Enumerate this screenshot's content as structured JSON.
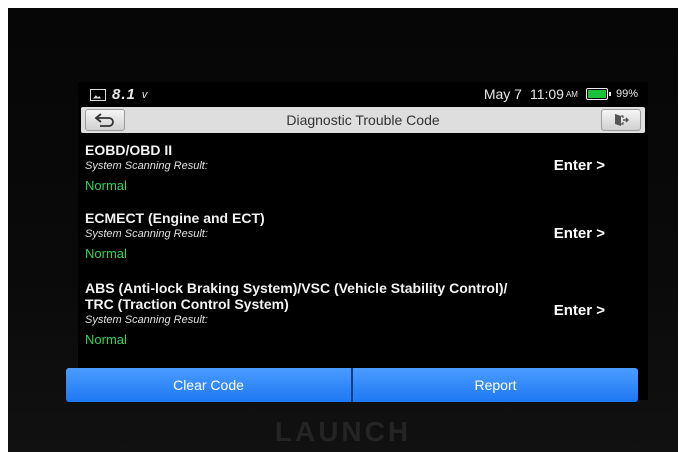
{
  "status_bar": {
    "version": "8.1",
    "version_suffix": "v",
    "date": "May 7",
    "time": "11:09",
    "ampm": "AM",
    "battery": "99%"
  },
  "header": {
    "title": "Diagnostic Trouble Code"
  },
  "systems": [
    {
      "name": "EOBD/OBD II",
      "scan_label": "System Scanning Result:",
      "status": "Normal",
      "action": "Enter >"
    },
    {
      "name": "ECMECT (Engine and ECT)",
      "scan_label": "System Scanning Result:",
      "status": "Normal",
      "action": "Enter >"
    },
    {
      "name_line1": "ABS (Anti-lock Braking System)/VSC (Vehicle Stability Control)/",
      "name_line2": "TRC (Traction Control System)",
      "scan_label": "System Scanning Result:",
      "status": "Normal",
      "action": "Enter >"
    }
  ],
  "footer": {
    "clear_code_label": "Clear Code",
    "report_label": "Report"
  },
  "brand": "LAUNCH"
}
